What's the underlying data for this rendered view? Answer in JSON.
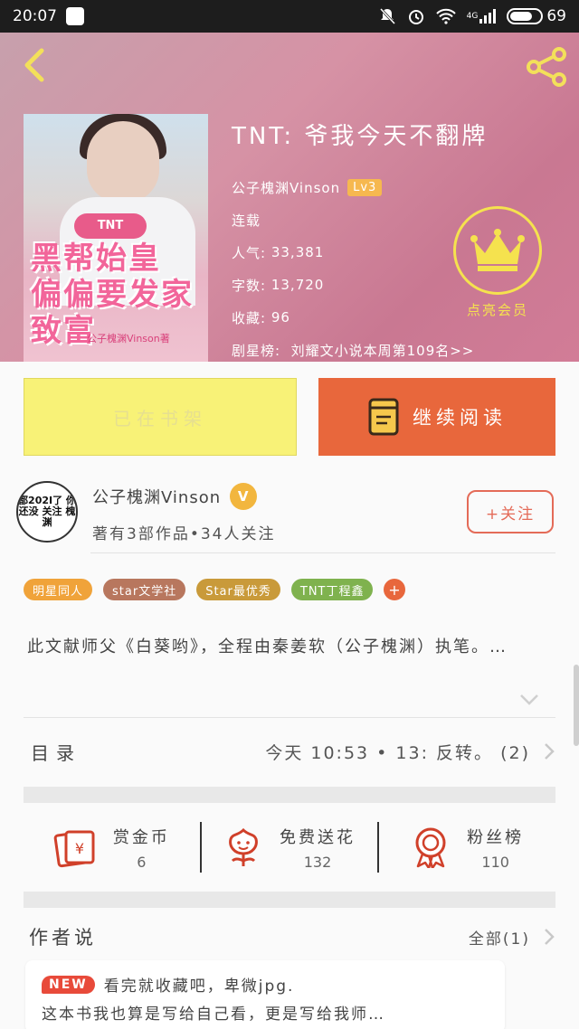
{
  "status_bar": {
    "time": "20:07",
    "network": "4G",
    "battery": "69"
  },
  "book": {
    "title": "TNT: 爷我今天不翻牌",
    "author": "公子槐渊Vinson",
    "level": "Lv3",
    "status": "连载",
    "popularity_label": "人气:",
    "popularity": "33,381",
    "words_label": "字数:",
    "words": "13,720",
    "favorites_label": "收藏:",
    "favorites": "96",
    "rank_label": "剧星榜:",
    "rank_text": "刘耀文小说本周第109名>>",
    "cover": {
      "badge": "TNT",
      "title": "黑帮始皇 偏偏要发家致富",
      "byline": "公子槐渊Vinson著"
    }
  },
  "vip": {
    "label": "点亮会员"
  },
  "buttons": {
    "shelf": "已在书架",
    "read": "继续阅读"
  },
  "author_card": {
    "name": "公子槐渊Vinson",
    "badge": "V",
    "desc": "著有3部作品•34人关注",
    "follow": "+关注",
    "avatar_text": "都202I了 你还没 关注 槐渊"
  },
  "tags": [
    {
      "label": "明星同人",
      "color": "#f0a33a"
    },
    {
      "label": "star文学社",
      "color": "#b8775e"
    },
    {
      "label": "Star最优秀",
      "color": "#c99a3a"
    },
    {
      "label": "TNT丁程鑫",
      "color": "#7fb24e"
    },
    {
      "label": "+",
      "color": "#e8673c"
    }
  ],
  "intro": "此文献师父《白葵哟》，全程由秦姜软（公子槐渊）执笔。…",
  "toc": {
    "label": "目录",
    "latest": "今天 10:53 • 13: 反转。 (2)"
  },
  "stats": [
    {
      "label": "赏金币",
      "value": "6",
      "icon": "red-envelope-icon"
    },
    {
      "label": "免费送花",
      "value": "132",
      "icon": "flower-icon"
    },
    {
      "label": "粉丝榜",
      "value": "110",
      "icon": "medal-icon"
    }
  ],
  "author_says": {
    "label": "作者说",
    "all": "全部(1)",
    "new_badge": "NEW",
    "line1": "看完就收藏吧，卑微jpg.",
    "line2": "这本书我也算是写给自己看，更是写给我师…"
  },
  "colors": {
    "accent": "#e8673c",
    "shelf_bg": "#f8f277",
    "vip": "#f5e24e"
  }
}
